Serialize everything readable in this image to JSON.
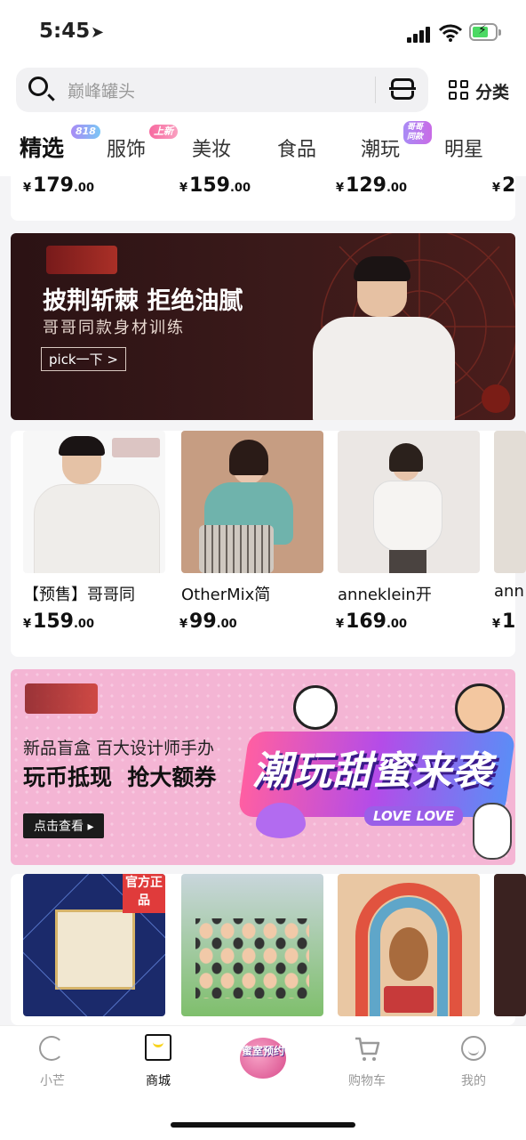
{
  "status": {
    "time": "5:45"
  },
  "search": {
    "placeholder": "巅峰罐头",
    "category_label": "分类"
  },
  "tabs": [
    {
      "label": "精选",
      "badge": "818"
    },
    {
      "label": "服饰",
      "badge": "上新"
    },
    {
      "label": "美妆"
    },
    {
      "label": "食品"
    },
    {
      "label": "潮玩",
      "badge": "哥哥同款"
    },
    {
      "label": "明星"
    }
  ],
  "top_prices": [
    {
      "currency": "¥",
      "int": "179",
      "dec": ".00"
    },
    {
      "currency": "¥",
      "int": "159",
      "dec": ".00"
    },
    {
      "currency": "¥",
      "int": "129",
      "dec": ".00"
    },
    {
      "currency": "¥",
      "int": "2",
      "dec": ""
    }
  ],
  "banner1": {
    "headline": "披荆斩棘 拒绝油腻",
    "subtitle": "哥哥同款身材训练",
    "cta": "pick一下 >"
  },
  "row2": [
    {
      "title": "【预售】哥哥同",
      "currency": "¥",
      "int": "159",
      "dec": ".00"
    },
    {
      "title": "OtherMix简",
      "currency": "¥",
      "int": "99",
      "dec": ".00"
    },
    {
      "title": "anneklein开",
      "currency": "¥",
      "int": "169",
      "dec": ".00"
    },
    {
      "title": "ann",
      "currency": "¥",
      "int": "1",
      "dec": ""
    }
  ],
  "banner2": {
    "line1": "新品盲盒 百大设计师手办",
    "line2": "玩币抵现  抢大额券",
    "cta": "点击查看",
    "headline": "潮玩甜蜜来袭",
    "tag": "LOVE LOVE",
    "badge": "官方正品"
  },
  "nav": [
    {
      "label": "小芒"
    },
    {
      "label": "商城"
    },
    {
      "label": "蜜室预约"
    },
    {
      "label": "购物车"
    },
    {
      "label": "我的"
    }
  ],
  "colors": {
    "accent_yellow": "#f8d31e",
    "banner_pink": "#f4b5d4",
    "banner_dark": "#2b1214"
  }
}
